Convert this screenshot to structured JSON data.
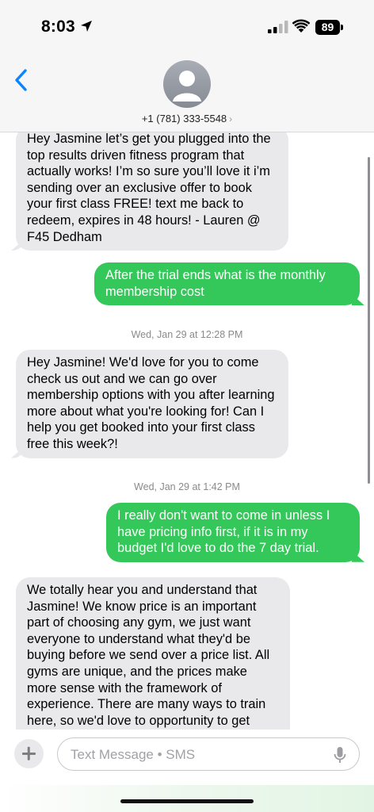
{
  "status": {
    "time": "8:03",
    "battery": "89"
  },
  "header": {
    "contact": "+1 (781) 333-5548",
    "chevron": "›"
  },
  "messages": [
    {
      "type": "received",
      "text": "Hey Jasmine let’s get you plugged into the top results driven fitness program that actually works! I’m so sure you’ll love it i’m sending over an exclusive offer to book your first class FREE! text me back to redeem, expires in 48 hours! - Lauren @ F45 Dedham"
    },
    {
      "type": "sent",
      "text": "After the trial ends what is the monthly membership cost"
    },
    {
      "type": "timestamp",
      "day": "Wed, Jan 29",
      "time": "at 12:28 PM"
    },
    {
      "type": "received",
      "text": "Hey Jasmine! We'd love for you to come check us out and we can go over membership options with you after learning more about what you're looking for! Can I help you get booked into your first class free this week?!"
    },
    {
      "type": "timestamp",
      "day": "Wed, Jan 29",
      "time": "at 1:42 PM"
    },
    {
      "type": "sent",
      "text": "I really don't want to come in unless I have pricing info first, if it is in my budget I'd love to do the 7 day trial."
    },
    {
      "type": "received",
      "text": "We totally hear you and understand that Jasmine! We know price is an important part of choosing any gym, we just want everyone to understand what they'd be buying before we send over a price list. All gyms are unique, and the prices make more sense with the framework of experience. There are many ways to train here, so we'd love to opportunity to get"
    }
  ],
  "input": {
    "placeholder": "Text Message • SMS"
  },
  "icons": [
    "location-arrow-icon",
    "cellular-signal-icon",
    "wifi-icon",
    "battery-icon",
    "back-chevron-icon",
    "contact-avatar-icon",
    "plus-icon",
    "microphone-icon"
  ],
  "colors": {
    "sent_bubble": "#34c759",
    "received_bubble": "#e9e9eb",
    "accent": "#0a84ff"
  }
}
